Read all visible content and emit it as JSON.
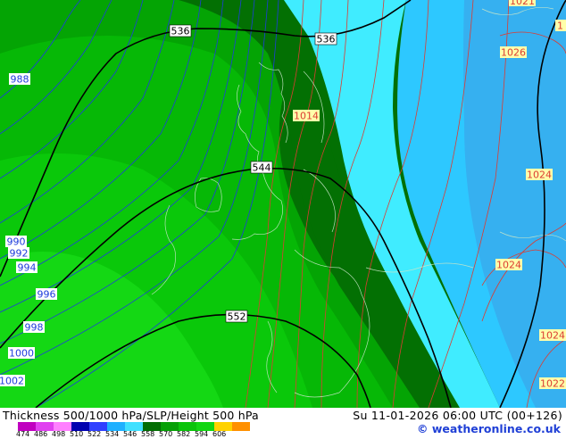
{
  "map": {
    "thickness_labels": [
      {
        "text": "536",
        "role": "536-a"
      },
      {
        "text": "536",
        "role": "536-b"
      },
      {
        "text": "544",
        "role": "544"
      },
      {
        "text": "552",
        "role": "552"
      }
    ],
    "isobar_labels_blue": [
      "988",
      "990",
      "992",
      "994",
      "996",
      "998",
      "1000",
      "1002"
    ],
    "isobar_labels_red": [
      "1021",
      "1026",
      "1014",
      "1024",
      "1024",
      "1024",
      "1022"
    ],
    "isobar_label_top_right_partial": "1",
    "colors": {
      "sea_dark_green": "#037003",
      "green_mid": "#04a404",
      "green_light": "#08c808",
      "green_bright": "#10d610",
      "cyan": "#40ecff",
      "light_blue": "#2dc8ff",
      "blue": "#36b0f0",
      "isobar_blue": "#1e3cdc",
      "isobar_red": "#dc3c32",
      "thickness_line": "#000000",
      "label_box": "#ffffaa"
    }
  },
  "footer": {
    "title": "Thickness 500/1000 hPa/SLP/Height 500 hPa",
    "datetime": "Su 11-01-2026 06:00 UTC (00+126)",
    "copyright": "© weatheronline.co.uk",
    "legend_values": [
      "474",
      "486",
      "498",
      "510",
      "522",
      "534",
      "546",
      "558",
      "570",
      "582",
      "594",
      "606"
    ],
    "legend_colors": [
      "#c000c0",
      "#e040f0",
      "#ff80ff",
      "#0000b0",
      "#3040ff",
      "#1fb0ff",
      "#40e0ff",
      "#036e03",
      "#07a007",
      "#0ac40a",
      "#12d612",
      "#ffd200",
      "#ff9000"
    ]
  }
}
